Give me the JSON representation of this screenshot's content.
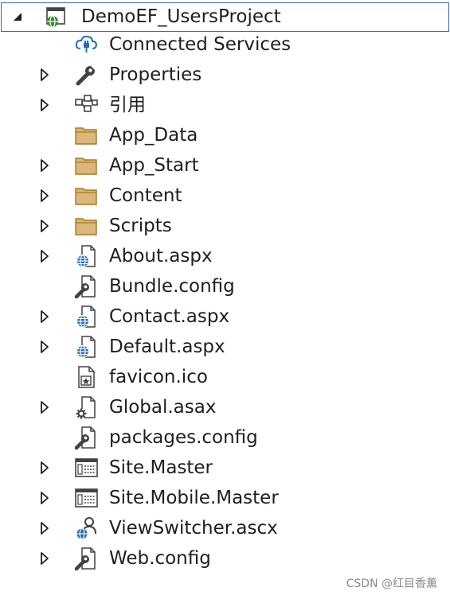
{
  "solution_explorer": {
    "project": {
      "label": "DemoEF_UsersProject",
      "icon": "web-project-icon"
    },
    "items": [
      {
        "label": "Connected Services",
        "icon": "connected-services-icon",
        "expandable": false
      },
      {
        "label": "Properties",
        "icon": "wrench-icon",
        "expandable": true
      },
      {
        "label": "引用",
        "icon": "references-icon",
        "expandable": true
      },
      {
        "label": "App_Data",
        "icon": "folder-icon",
        "expandable": false
      },
      {
        "label": "App_Start",
        "icon": "folder-icon",
        "expandable": true
      },
      {
        "label": "Content",
        "icon": "folder-icon",
        "expandable": true
      },
      {
        "label": "Scripts",
        "icon": "folder-icon",
        "expandable": true
      },
      {
        "label": "About.aspx",
        "icon": "aspx-file-icon",
        "expandable": true
      },
      {
        "label": "Bundle.config",
        "icon": "config-file-icon",
        "expandable": false
      },
      {
        "label": "Contact.aspx",
        "icon": "aspx-file-icon",
        "expandable": true
      },
      {
        "label": "Default.aspx",
        "icon": "aspx-file-icon",
        "expandable": true
      },
      {
        "label": "favicon.ico",
        "icon": "ico-file-icon",
        "expandable": false
      },
      {
        "label": "Global.asax",
        "icon": "asax-file-icon",
        "expandable": true
      },
      {
        "label": "packages.config",
        "icon": "config-file-icon",
        "expandable": false
      },
      {
        "label": "Site.Master",
        "icon": "master-page-icon",
        "expandable": true
      },
      {
        "label": "Site.Mobile.Master",
        "icon": "master-page-icon",
        "expandable": true
      },
      {
        "label": "ViewSwitcher.ascx",
        "icon": "user-control-icon",
        "expandable": true
      },
      {
        "label": "Web.config",
        "icon": "config-file-icon",
        "expandable": true
      }
    ]
  },
  "watermark": "CSDN @红目香薰",
  "colors": {
    "selection_border": "#3c63c8",
    "folder": "#dcb67a",
    "globe": "#1f6fc1",
    "text": "#1e1e1e"
  }
}
